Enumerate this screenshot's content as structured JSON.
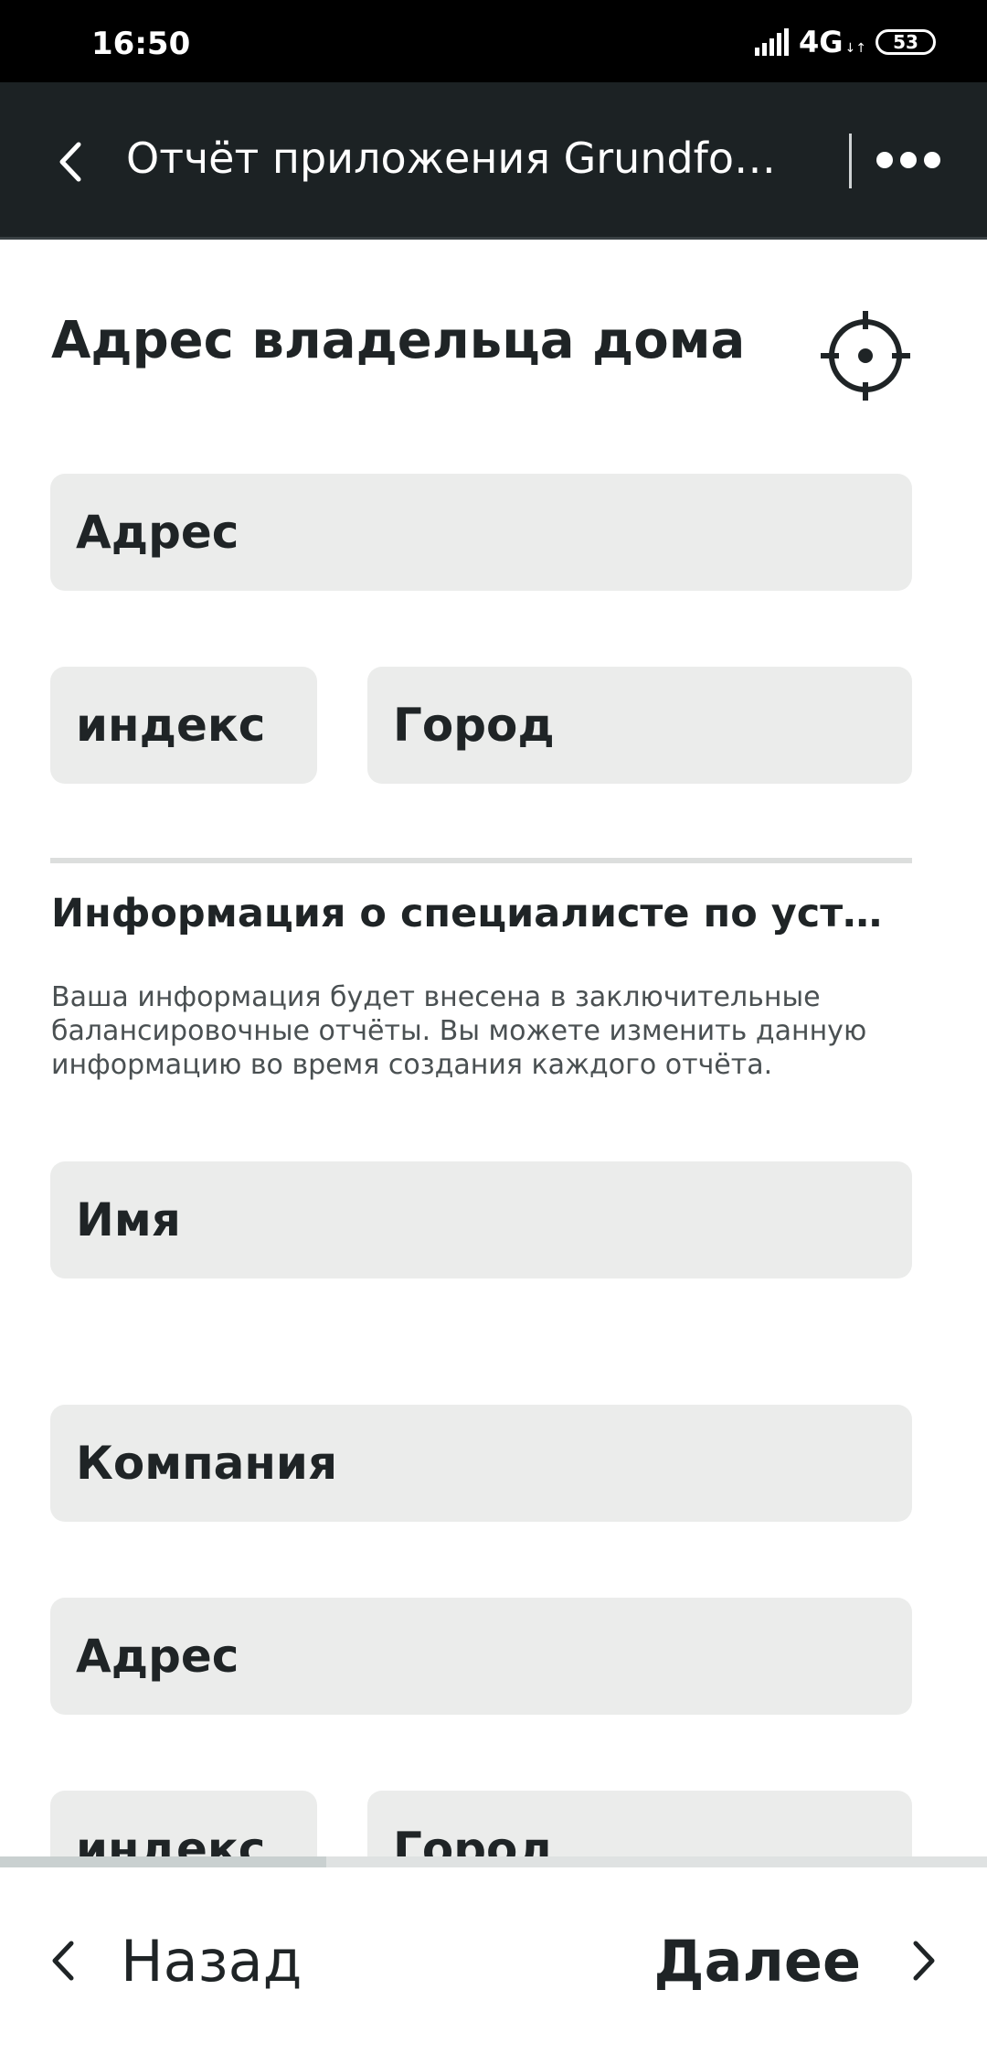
{
  "status_bar": {
    "time": "16:50",
    "network": "4G",
    "battery": "53"
  },
  "app_bar": {
    "title": "Отчёт приложения Grundfos G..."
  },
  "owner_section": {
    "title": "Адрес владельца дома",
    "fields": {
      "address": "Адрес",
      "postcode": "индекс",
      "city": "Город"
    }
  },
  "installer_section": {
    "title": "Информация о специалисте по установ...",
    "description": "Ваша информация будет внесена в заключительные балансировочные отчёты. Вы можете изменить данную информацию во время создания каждого отчёта.",
    "fields": {
      "name": "Имя",
      "company": "Компания",
      "address": "Адрес",
      "postcode": "индекс",
      "city": "Город"
    }
  },
  "bottom_nav": {
    "back_label": "Назад",
    "next_label": "Далее"
  },
  "colors": {
    "app_bar_bg": "#1c2224",
    "field_bg": "#ebeceb",
    "text": "#1f2426"
  },
  "icons": {
    "back": "chevron-left-icon",
    "more": "more-horizontal-icon",
    "locate": "crosshair-locate-icon"
  }
}
